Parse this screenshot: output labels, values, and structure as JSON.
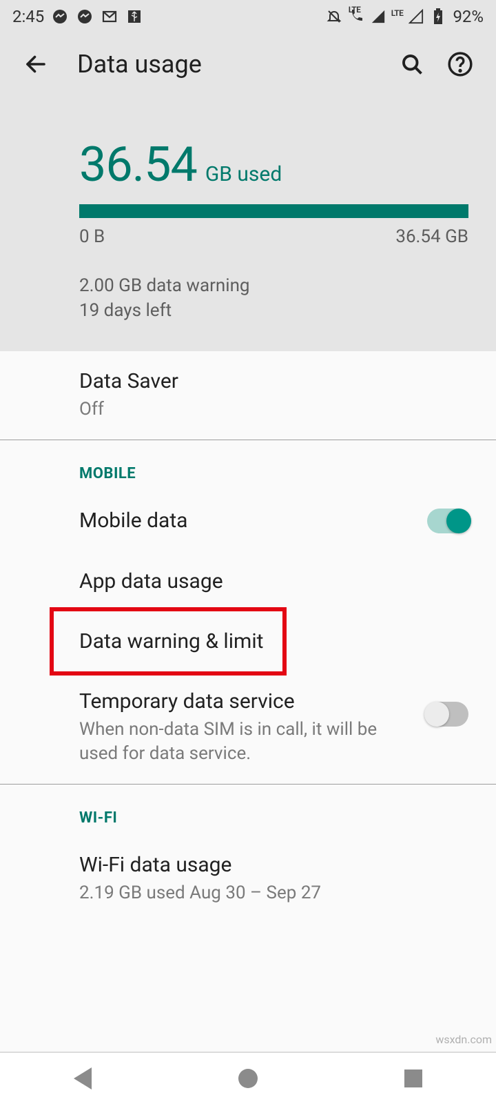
{
  "status": {
    "time": "2:45",
    "battery": "92%",
    "lte1": "LTE",
    "lte2": "LTE"
  },
  "header": {
    "title": "Data usage"
  },
  "usage": {
    "amount": "36.54",
    "suffix": "GB used",
    "min_label": "0 B",
    "max_label": "36.54 GB",
    "warning_line1": "2.00 GB data warning",
    "warning_line2": "19 days left"
  },
  "data_saver": {
    "title": "Data Saver",
    "status": "Off"
  },
  "mobile": {
    "section_label": "MOBILE",
    "mobile_data": {
      "title": "Mobile data",
      "enabled": true
    },
    "app_data_usage": {
      "title": "App data usage"
    },
    "data_warning_limit": {
      "title": "Data warning & limit"
    },
    "temp_data_service": {
      "title": "Temporary data service",
      "subtitle": "When non-data SIM is in call, it will be used for data service.",
      "enabled": false
    }
  },
  "wifi": {
    "section_label": "WI-FI",
    "wifi_data_usage": {
      "title": "Wi-Fi data usage",
      "subtitle": "2.19 GB used Aug 30 – Sep 27"
    }
  },
  "watermark": "wsxdn.com"
}
